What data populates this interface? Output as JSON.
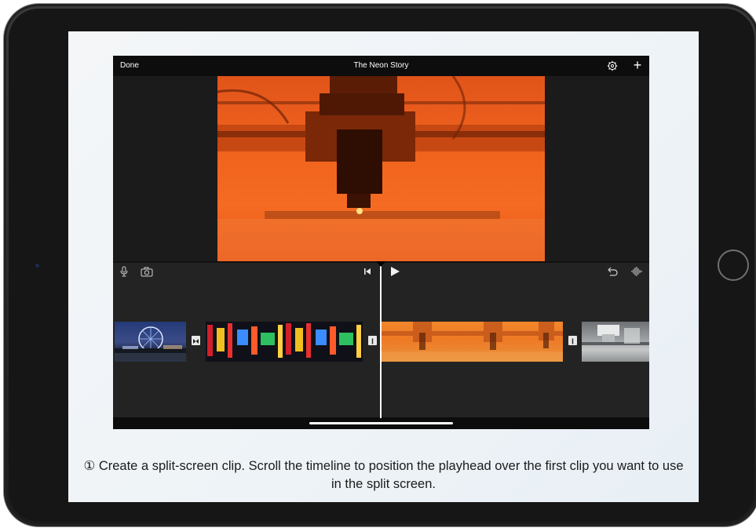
{
  "app": {
    "done_label": "Done",
    "project_title": "The Neon Story",
    "settings_icon": "gear-icon",
    "add_icon": "plus-icon",
    "add_label": "+"
  },
  "timeline": {
    "tools_left": [
      "microphone-icon",
      "camera-icon"
    ],
    "transport": [
      "skip-to-start-icon",
      "play-icon"
    ],
    "tools_right": [
      "undo-icon",
      "audio-waveform-icon"
    ],
    "clips": [
      {
        "name": "ferris-wheel-clip"
      },
      {
        "name": "neon-city-clip"
      },
      {
        "name": "laser-cutter-clip"
      },
      {
        "name": "machine-clip"
      }
    ]
  },
  "caption": {
    "text": "① Create a split-screen clip. Scroll the timeline to position the playhead over the first clip you want to use in the split screen."
  },
  "colors": {
    "app_background": "#1e1e1e",
    "video_orange": "#f0631e",
    "text_dark": "#1b1b1b"
  }
}
